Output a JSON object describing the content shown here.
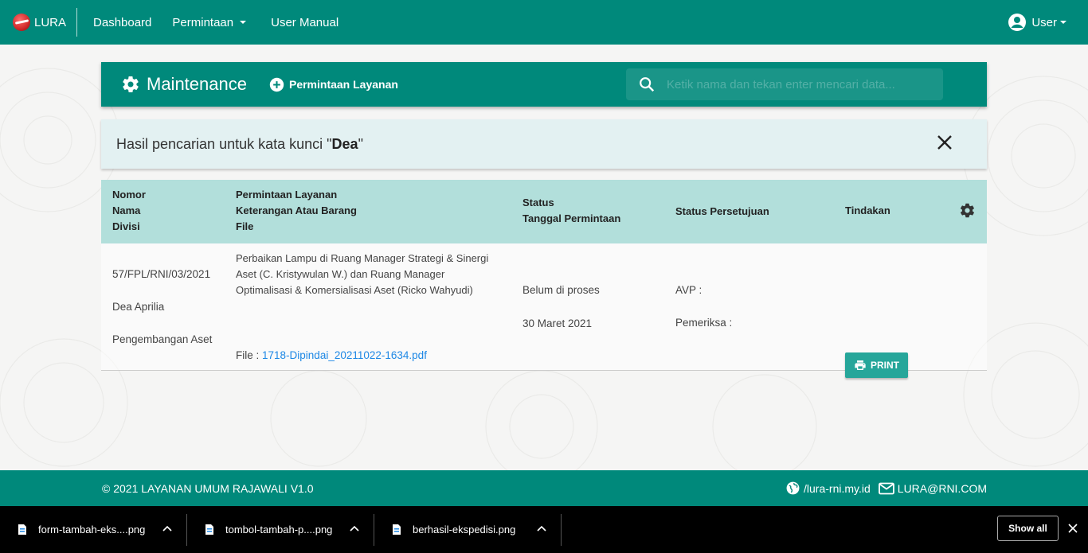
{
  "navbar": {
    "brand": "LURA",
    "links": [
      "Dashboard",
      "Permintaan",
      "User Manual"
    ],
    "user_label": "User"
  },
  "header": {
    "title": "Maintenance",
    "add_label": "Permintaan Layanan",
    "search_placeholder": "Ketik nama dan tekan enter mencari data..."
  },
  "alert": {
    "prefix": "Hasil pencarian untuk kata kunci \"",
    "keyword": "Dea",
    "suffix": "\""
  },
  "table": {
    "headers": {
      "col1": [
        "Nomor",
        "Nama",
        "Divisi"
      ],
      "col2": [
        "Permintaan Layanan",
        "Keterangan Atau Barang",
        "File"
      ],
      "col3": [
        "Status",
        "Tanggal Permintaan"
      ],
      "col4": "Status Persetujuan",
      "col5": "Tindakan"
    },
    "rows": [
      {
        "nomor": "57/FPL/RNI/03/2021",
        "nama": "Dea Aprilia",
        "divisi": "Pengembangan Aset",
        "keterangan_lines": [
          "Perbaikan Lampu di Ruang Manager Strategi & Sinergi",
          "Aset (C. Kristywulan W.) dan Ruang Manager",
          "Optimalisasi & Komersialisasi Aset (Ricko Wahyudi)"
        ],
        "file_label": "File : ",
        "file_name": "1718-Dipindai_20211022-1634.pdf",
        "status": "Belum di proses",
        "tanggal": "30 Maret 2021",
        "avp": "AVP :",
        "pemeriksa": "Pemeriksa :",
        "action_label": "PRINT"
      }
    ]
  },
  "footer": {
    "copyright": "© 2021 LAYANAN UMUM RAJAWALI V1.0",
    "website": "/lura-rni.my.id",
    "email": "LURA@RNI.COM"
  },
  "downloads": {
    "items": [
      "form-tambah-eks....png",
      "tombol-tambah-p....png",
      "berhasil-ekspedisi.png"
    ],
    "show_all": "Show all"
  },
  "colors": {
    "primary": "#00897b",
    "table_header": "#b2dfdb",
    "alert_bg": "#e3f1f2",
    "button": "#26a69a",
    "link": "#1e88e5"
  }
}
